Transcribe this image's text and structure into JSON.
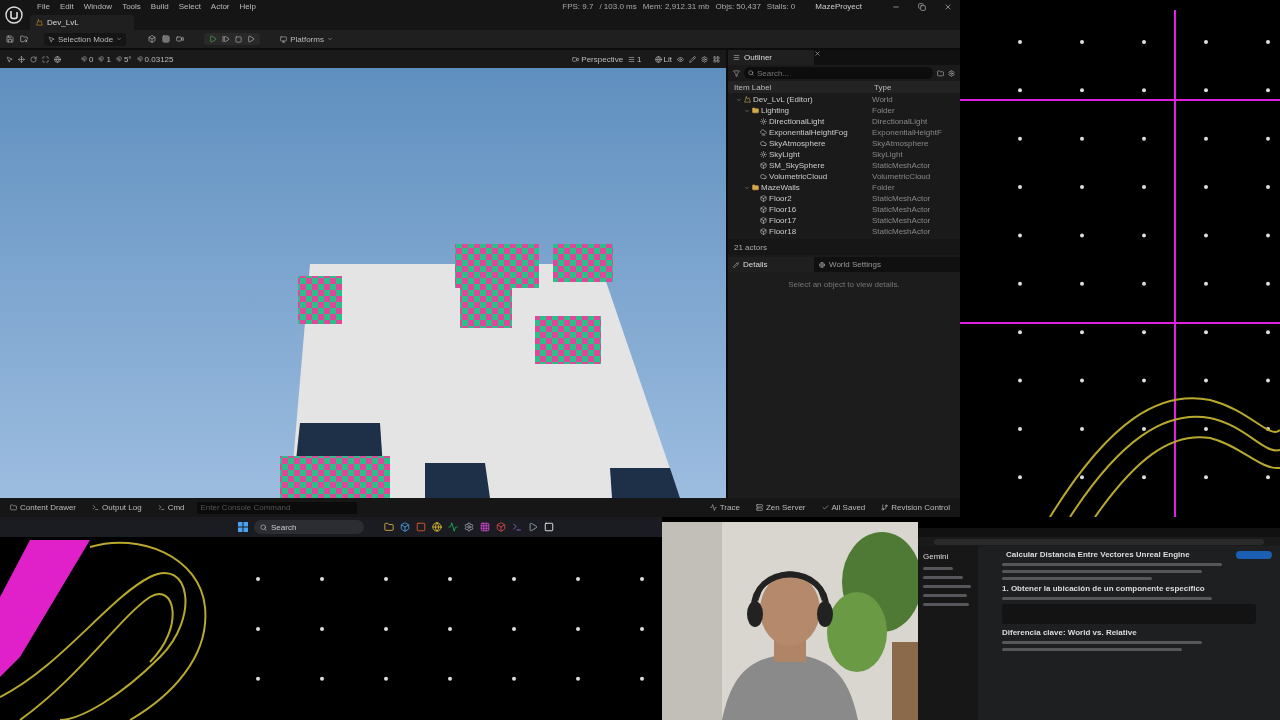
{
  "window": {
    "menu": [
      "File",
      "Edit",
      "Window",
      "Tools",
      "Build",
      "Select",
      "Actor",
      "Help"
    ],
    "stats": [
      "FPS: 9.7",
      "/ 103.0 ms",
      "Mem: 2,912.31 mb",
      "Objs: 50,437",
      "Stalls: 0"
    ],
    "project": "MazeProyect"
  },
  "level_tabs": [
    {
      "label": "Dev_LvL",
      "selected": true
    }
  ],
  "toolbar": {
    "mode": "Selection Mode",
    "platforms": "Platforms"
  },
  "viewport_toolbar": {
    "snaps": [
      "0",
      "1",
      "5°",
      "0.03125"
    ],
    "view": "Perspective",
    "layout": "1",
    "lighting": "Lit"
  },
  "outliner": {
    "title": "Outliner",
    "search": {
      "placeholder": "Search..."
    },
    "columns": [
      "Item Label",
      "Type"
    ],
    "tree": [
      {
        "label": "Dev_LvL (Editor)",
        "type": "World",
        "kind": "world",
        "expanded": true,
        "children": [
          {
            "label": "Lighting",
            "type": "Folder",
            "kind": "folder",
            "expanded": true,
            "children": [
              {
                "label": "DirectionalLight",
                "type": "DirectionalLight",
                "kind": "light"
              },
              {
                "label": "ExponentialHeightFog",
                "type": "ExponentialHeightF",
                "kind": "fog"
              },
              {
                "label": "SkyAtmosphere",
                "type": "SkyAtmosphere",
                "kind": "sky"
              },
              {
                "label": "SkyLight",
                "type": "SkyLight",
                "kind": "light"
              },
              {
                "label": "SM_SkySphere",
                "type": "StaticMeshActor",
                "kind": "mesh"
              },
              {
                "label": "VolumetricCloud",
                "type": "VolumetricCloud",
                "kind": "cloud"
              }
            ]
          },
          {
            "label": "MazeWalls",
            "type": "Folder",
            "kind": "folder",
            "expanded": true,
            "children": [
              {
                "label": "Floor2",
                "type": "StaticMeshActor",
                "kind": "mesh"
              },
              {
                "label": "Floor16",
                "type": "StaticMeshActor",
                "kind": "mesh"
              },
              {
                "label": "Floor17",
                "type": "StaticMeshActor",
                "kind": "mesh"
              },
              {
                "label": "Floor18",
                "type": "StaticMeshActor",
                "kind": "mesh"
              }
            ]
          }
        ]
      }
    ],
    "footer": "21 actors"
  },
  "details": {
    "tabs": [
      {
        "label": "Details",
        "selected": true
      },
      {
        "label": "World Settings",
        "selected": false
      }
    ],
    "empty_message": "Select an object to view details."
  },
  "bottom_bar": {
    "left": [
      "Content Drawer",
      "Output Log",
      "Cmd"
    ],
    "console": {
      "placeholder": "Enter Console Command"
    },
    "right": [
      "Trace",
      "Zen Server",
      "All Saved",
      "Revision Control"
    ]
  },
  "taskbar": {
    "search": {
      "placeholder": "Search"
    }
  },
  "browser": {
    "sidebar_title": "Gemini",
    "page_title": "Calcular Distancia Entre Vectores Unreal Engine",
    "heading": "1. Obtener la ubicación de un componente específico",
    "subheading": "Diferencia clave: World vs. Relative"
  }
}
